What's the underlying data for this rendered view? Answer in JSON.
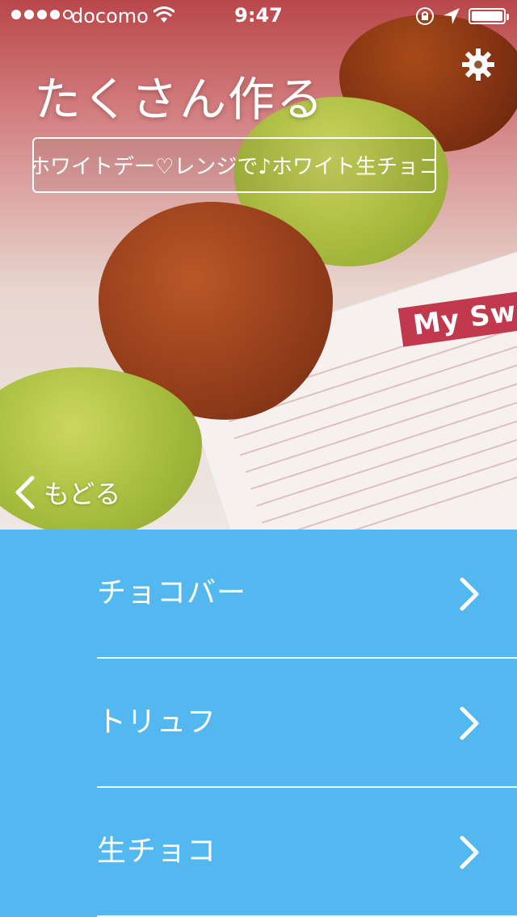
{
  "status_bar": {
    "carrier": "docomo",
    "time": "9:47"
  },
  "header": {
    "title": "たくさん作る",
    "recipe_title": "ホワイトデー♡レンジで♪ホワイト生チョコ",
    "back_label": "もどる"
  },
  "menu": {
    "items": [
      {
        "label": "チョコバー"
      },
      {
        "label": "トリュフ"
      },
      {
        "label": "生チョコ"
      }
    ]
  },
  "colors": {
    "menu_background": "#53b8f0",
    "text_on_menu": "#ffffff"
  },
  "icons": {
    "settings": "gear-icon",
    "back": "chevron-left-icon",
    "row": "chevron-right-icon"
  }
}
